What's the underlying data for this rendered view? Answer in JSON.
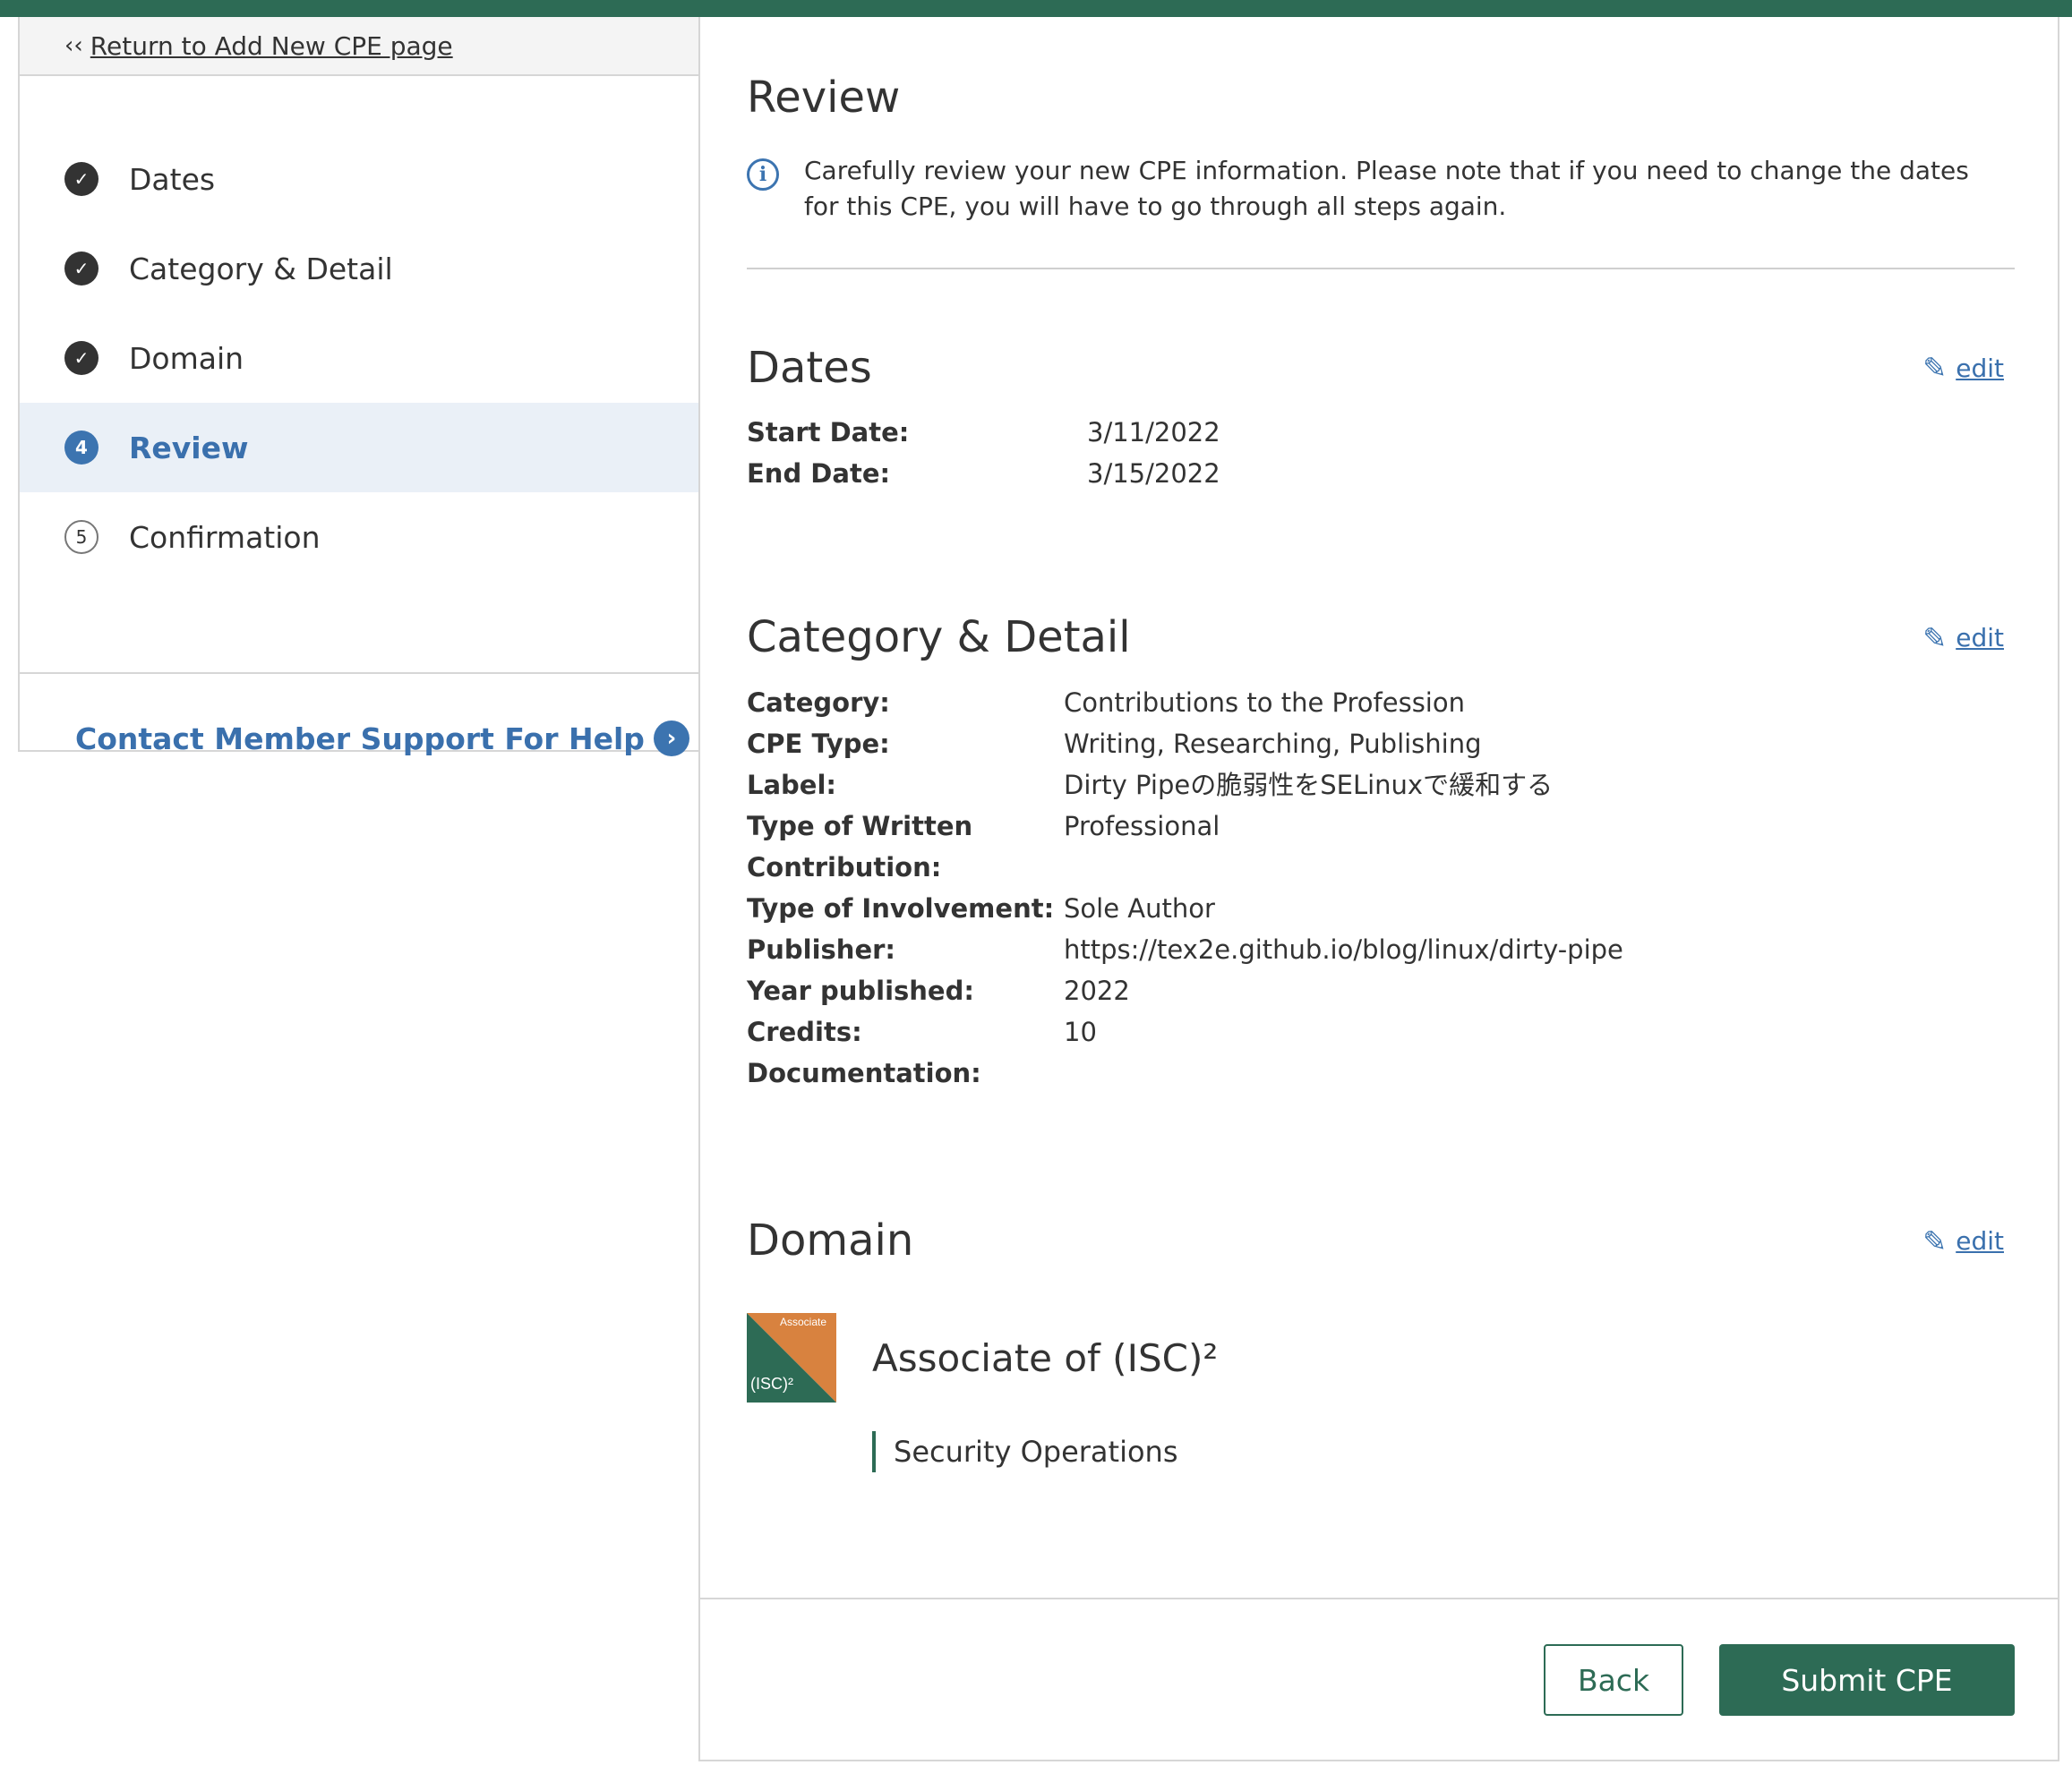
{
  "colors": {
    "brand_green": "#2d6b55",
    "accent_blue": "#3c74b0",
    "active_bg": "#eaf0f7"
  },
  "sidebar": {
    "return_chevron": "‹‹",
    "return_link": "Return to Add New CPE page",
    "steps": [
      {
        "number": "✓",
        "label": "Dates",
        "state": "done"
      },
      {
        "number": "✓",
        "label": "Category & Detail",
        "state": "done"
      },
      {
        "number": "✓",
        "label": "Domain",
        "state": "done"
      },
      {
        "number": "4",
        "label": "Review",
        "state": "current"
      },
      {
        "number": "5",
        "label": "Confirmation",
        "state": "todo"
      }
    ],
    "support_link": "Contact Member Support For Help",
    "support_arrow": "›"
  },
  "review": {
    "title": "Review",
    "info_icon": "i",
    "info_text": "Carefully review your new CPE information. Please note that if you need to change the dates for this CPE, you will have to go through all steps again."
  },
  "dates": {
    "title": "Dates",
    "edit_label": "edit",
    "start_label": "Start Date:",
    "start_value": "3/11/2022",
    "end_label": "End Date:",
    "end_value": "3/15/2022"
  },
  "category": {
    "title": "Category & Detail",
    "edit_label": "edit",
    "rows": [
      {
        "label": "Category:",
        "value": "Contributions to the Profession"
      },
      {
        "label": "CPE Type:",
        "value": "Writing, Researching, Publishing"
      },
      {
        "label": "Label:",
        "value": "Dirty Pipeの脆弱性をSELinuxで緩和する"
      },
      {
        "label": "Type of Written Contribution:",
        "value": "Professional"
      },
      {
        "label": "Type of Involvement:",
        "value": "Sole Author"
      },
      {
        "label": "Publisher:",
        "value": "https://tex2e.github.io/blog/linux/dirty-pipe"
      },
      {
        "label": "Year published:",
        "value": "2022"
      },
      {
        "label": "Credits:",
        "value": "10"
      },
      {
        "label": "Documentation:",
        "value": ""
      }
    ]
  },
  "domain": {
    "title": "Domain",
    "edit_label": "edit",
    "badge_top": "Associate",
    "badge_bottom": "(ISC)²",
    "name": "Associate of (ISC)²",
    "subdomain": "Security Operations"
  },
  "footer": {
    "back_label": "Back",
    "submit_label": "Submit CPE"
  }
}
